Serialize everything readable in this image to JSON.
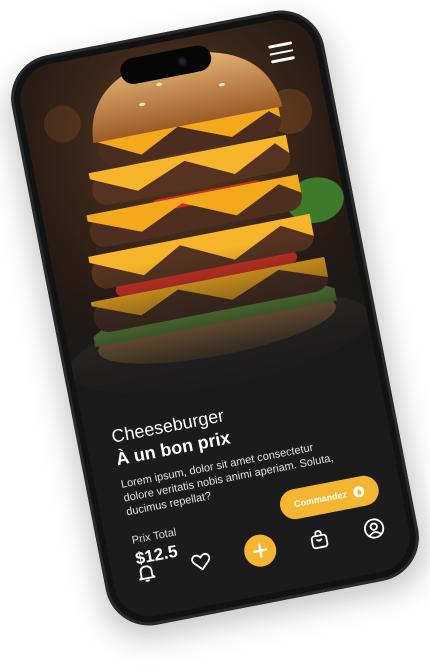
{
  "product": {
    "name": "Cheeseburger",
    "subtitle": "À un bon prix",
    "description": "Lorem ipsum, dolor sit amet consectetur dolore veritatis nobis animi aperiam. Soluta, ducimus repellat?",
    "image_icon": "burger-photo"
  },
  "price": {
    "label": "Prix Total",
    "value": "$12.5"
  },
  "order_button": {
    "label": "Commandez",
    "icon": "hand-pointer-icon"
  },
  "bottom_nav": {
    "items": [
      "bell-icon",
      "heart-icon",
      "plus-icon",
      "shopping-bag-icon",
      "user-icon"
    ]
  },
  "colors": {
    "accent": "#f4b532",
    "background": "#1b1b1c",
    "text": "#ffffff"
  }
}
